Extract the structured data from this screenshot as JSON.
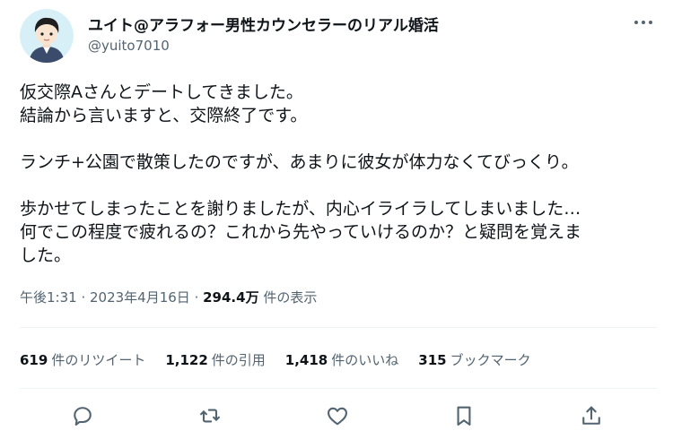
{
  "author": {
    "name": "ユイト@アラフォー男性カウンセラーのリアル婚活",
    "handle": "@yuito7010"
  },
  "tweet": {
    "lines": [
      "仮交際Aさんとデートしてきました。",
      "結論から言いますと、交際終了です。",
      "",
      "ランチ+公園で散策したのですが、あまりに彼女が体力なくてびっくり。",
      "",
      "歩かせてしまったことを謝りましたが、内心イライラしてしまいました…",
      "何でこの程度で疲れるの？これから先やっていけるのか？と疑問を覚えま",
      "した。"
    ]
  },
  "meta": {
    "time": "午後1:31",
    "separator1": " · ",
    "date": "2023年4月16日",
    "separator2": " · ",
    "views_count": "294.4万",
    "views_label": " 件の表示"
  },
  "stats": {
    "retweets_count": "619",
    "retweets_label": "件のリツイート",
    "quotes_count": "1,122",
    "quotes_label": "件の引用",
    "likes_count": "1,418",
    "likes_label": "件のいいね",
    "bookmarks_count": "315",
    "bookmarks_label": "ブックマーク"
  },
  "icons": {
    "more": "more-icon",
    "reply": "reply-icon",
    "retweet": "retweet-icon",
    "like": "like-icon",
    "bookmark": "bookmark-icon",
    "share": "share-icon"
  },
  "colors": {
    "text": "#0f1419",
    "secondary": "#536471",
    "divider": "#eff3f4",
    "avatar_bg": "#d7f0f8"
  }
}
